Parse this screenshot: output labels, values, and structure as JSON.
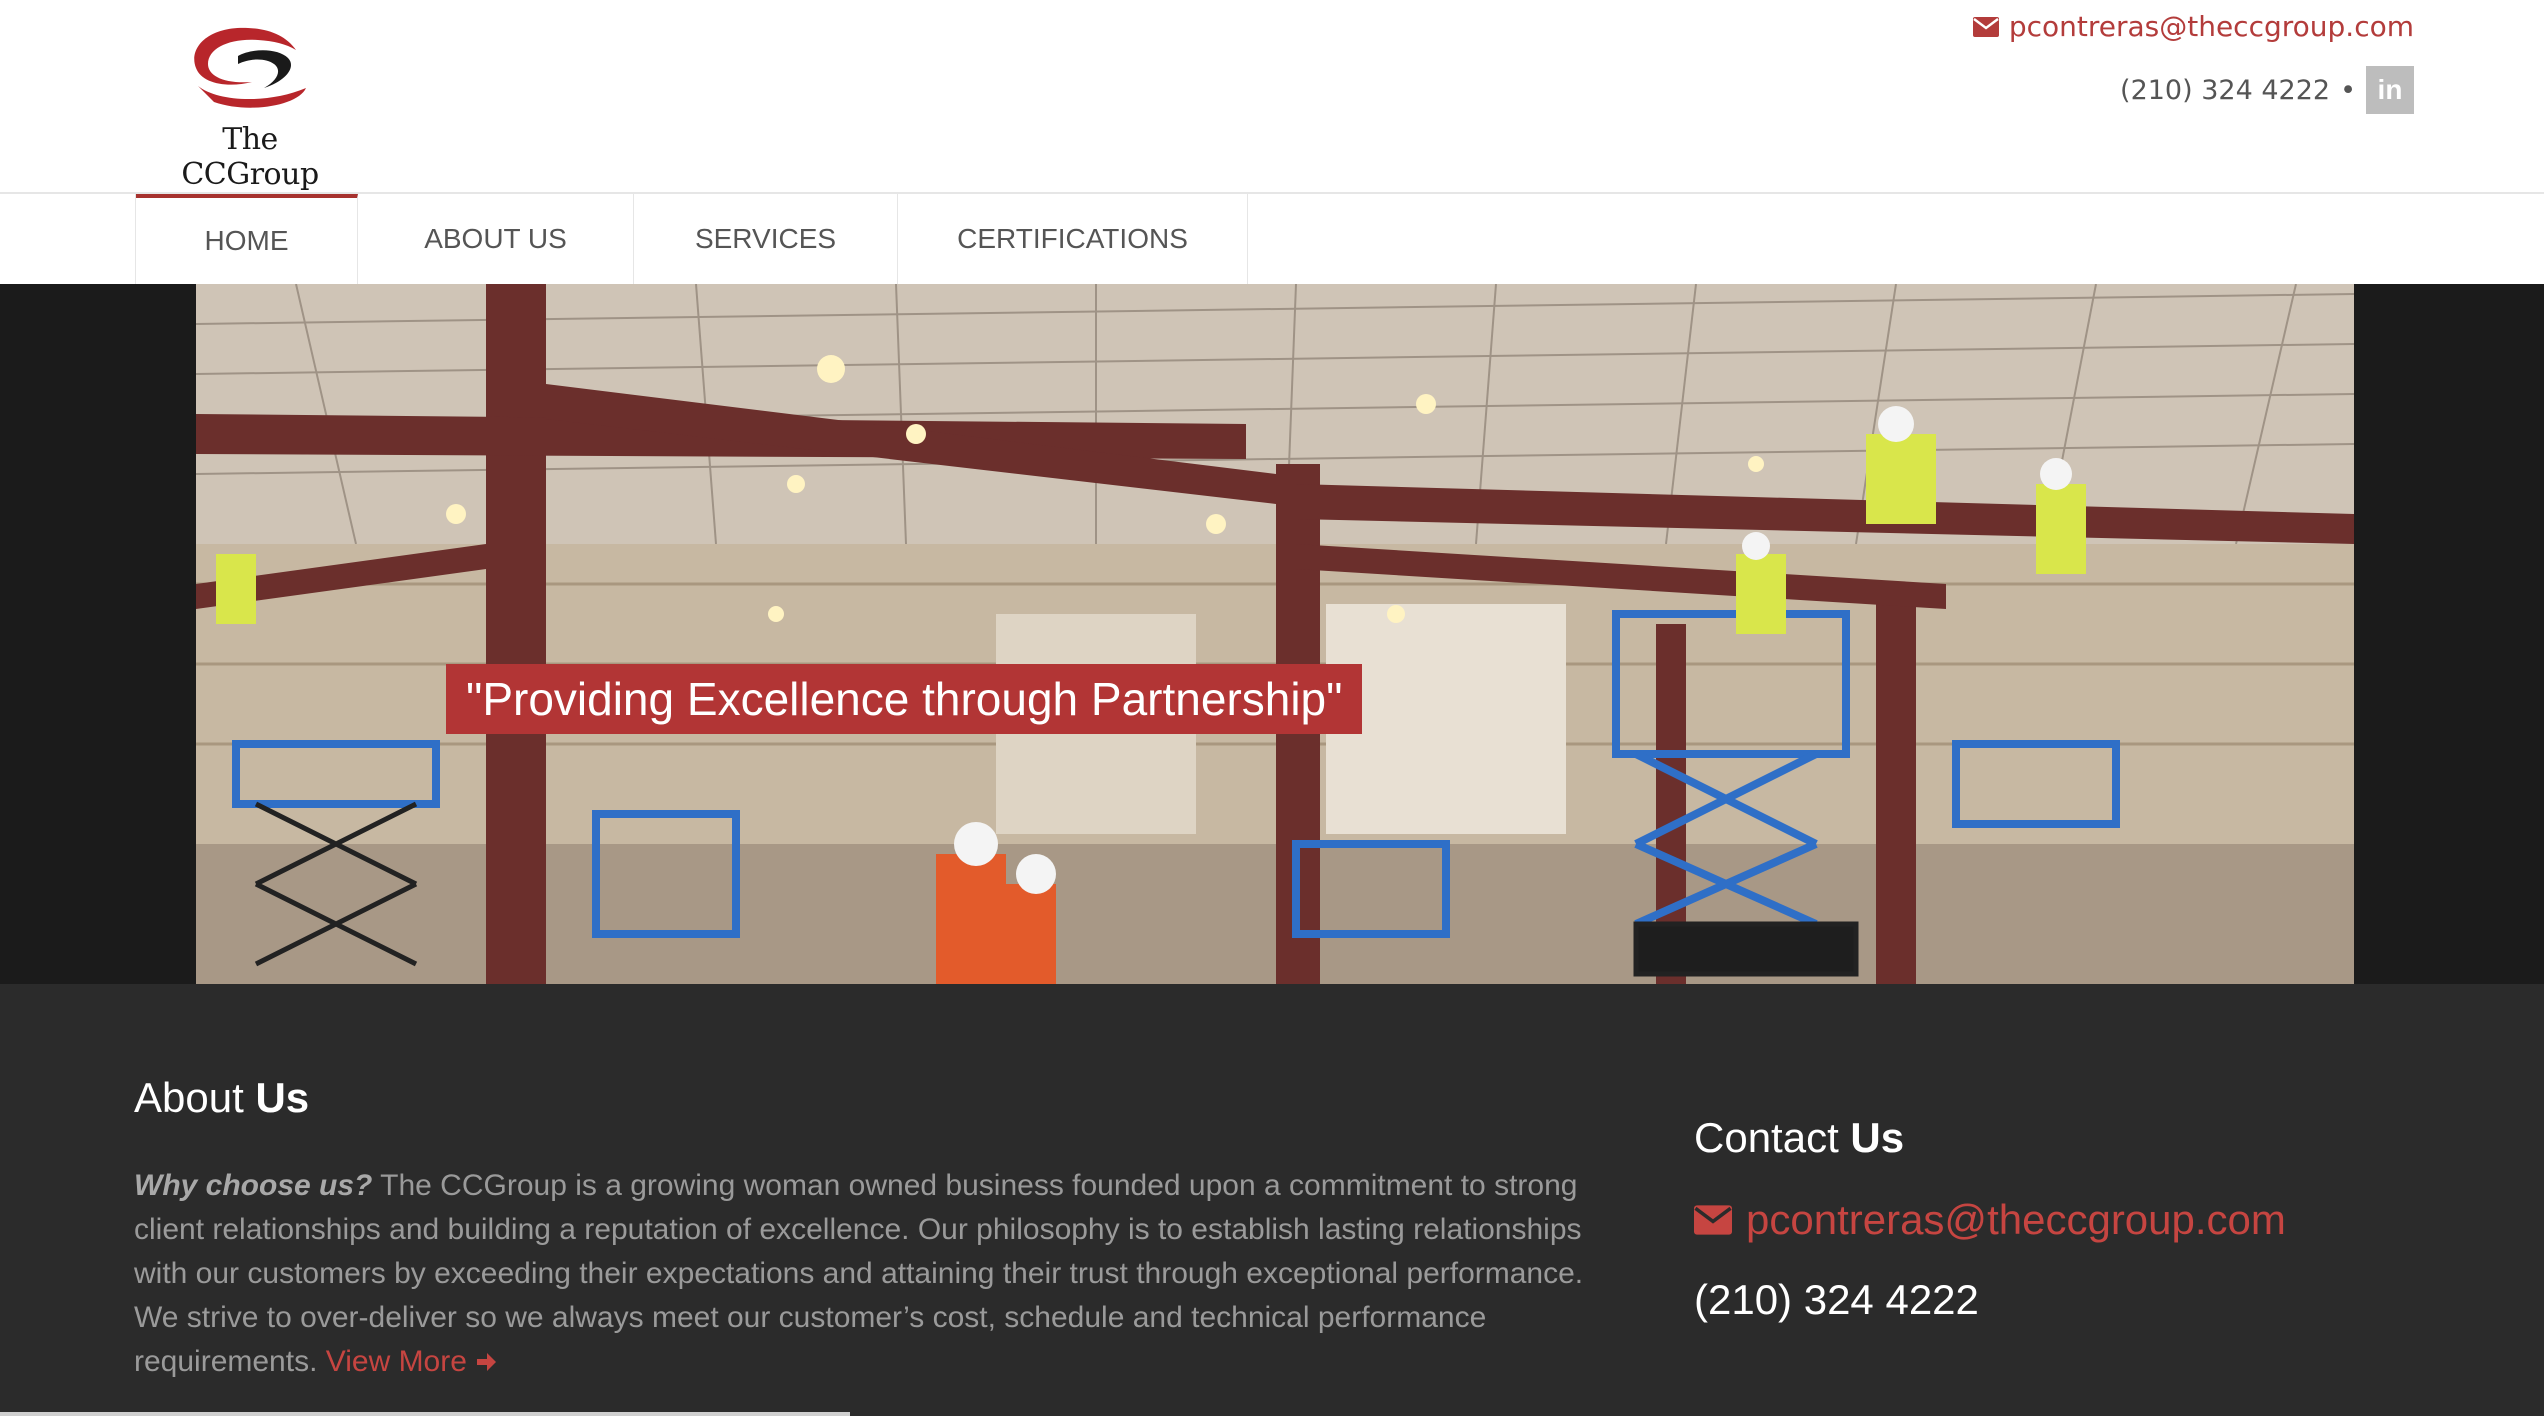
{
  "header": {
    "logo_text": "The CCGroup",
    "email": "pcontreras@theccgroup.com",
    "phone": "(210) 324 4222",
    "separator": "•",
    "linkedin_label": "in"
  },
  "nav": {
    "items": [
      {
        "label": "HOME",
        "active": true
      },
      {
        "label": "ABOUT US",
        "active": false
      },
      {
        "label": "SERVICES",
        "active": false
      },
      {
        "label": "CERTIFICATIONS",
        "active": false
      }
    ]
  },
  "hero": {
    "tagline": "\"Providing Excellence through Partnership\""
  },
  "about": {
    "title_light": "About ",
    "title_bold": "Us",
    "lead": "Why choose us?",
    "body": " The CCGroup is a growing woman owned business founded upon a commitment to strong client relationships and building a reputation of excellence. Our philosophy is to establish lasting relationships with our customers by exceeding their expectations and attaining their trust through exceptional performance. We strive to over-deliver so we always meet our customer’s cost, schedule and technical performance requirements. ",
    "view_more": "View More"
  },
  "contact": {
    "title_light": "Contact ",
    "title_bold": "Us",
    "email": "pcontreras@theccgroup.com",
    "phone": "(210) 324 4222"
  },
  "colors": {
    "accent": "#b33c3b",
    "footer_bg": "#2b2b2b",
    "hero_bg": "#1b1b1b"
  },
  "icons": {
    "email": "envelope-icon",
    "linkedin": "linkedin-icon",
    "view_more": "arrow-right-icon"
  }
}
